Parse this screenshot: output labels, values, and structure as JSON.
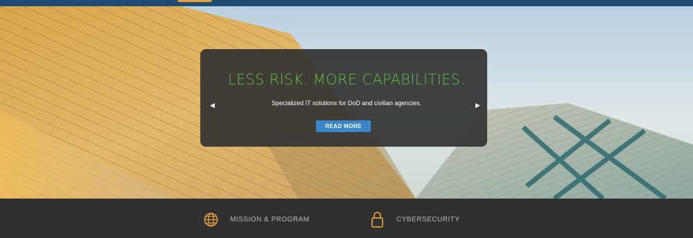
{
  "hero": {
    "headline": "LESS RISK. MORE CAPABILITIES.",
    "tagline": "Specialized IT solutions for DoD and civilian agencies.",
    "cta_label": "READ MORE",
    "prev_icon": "left-arrow-icon",
    "next_icon": "right-arrow-icon"
  },
  "services": [
    {
      "label": "MISSION & PROGRAM",
      "icon": "globe-icon"
    },
    {
      "label": "CYBERSECURITY",
      "icon": "lock-icon"
    }
  ],
  "colors": {
    "header": "#1e4a73",
    "accent": "#e8a13a",
    "headline": "#5fbf48",
    "button": "#3b86c8",
    "footer": "#303030"
  }
}
